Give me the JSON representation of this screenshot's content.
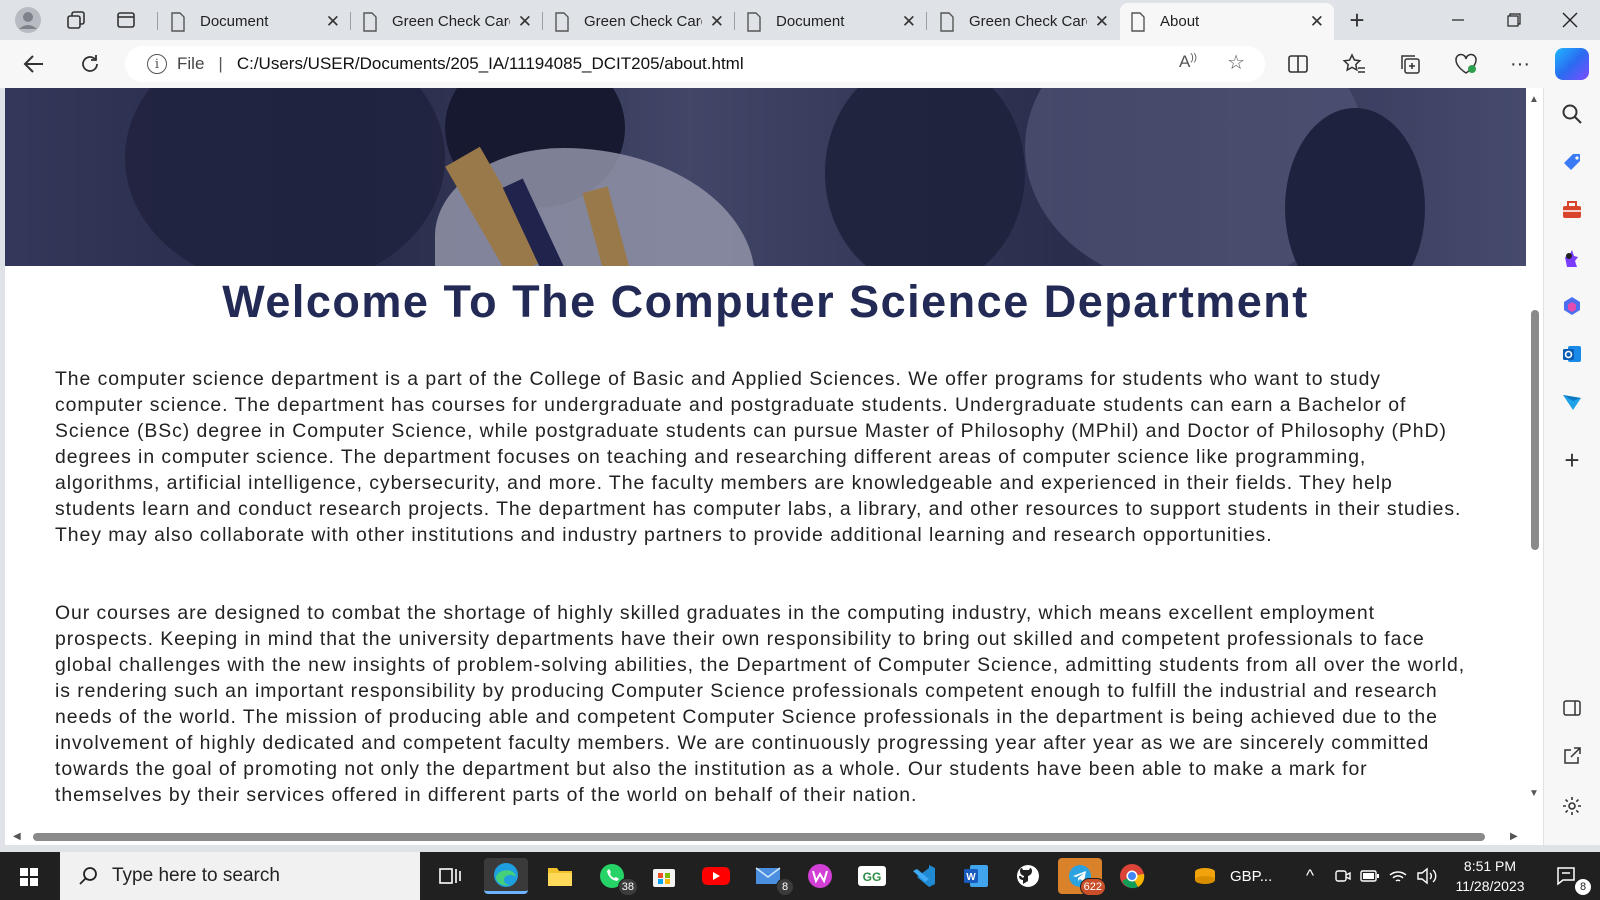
{
  "browser": {
    "tabs": [
      {
        "label": "Document",
        "active": false
      },
      {
        "label": "Green Check Card",
        "active": false
      },
      {
        "label": "Green Check Card",
        "active": false
      },
      {
        "label": "Document",
        "active": false
      },
      {
        "label": "Green Check Card",
        "active": false
      },
      {
        "label": "About",
        "active": true
      }
    ],
    "address": {
      "scheme_label": "File",
      "url": "C:/Users/USER/Documents/205_IA/11194085_DCIT205/about.html"
    }
  },
  "page": {
    "title": "Welcome To The Computer Science Department",
    "paragraphs": [
      "The computer science department is a part of the College of Basic and Applied Sciences. We offer programs for students who want to study computer science. The department has courses for undergraduate and postgraduate students. Undergraduate students can earn a Bachelor of Science (BSc) degree in Computer Science, while postgraduate students can pursue Master of Philosophy (MPhil) and Doctor of Philosophy (PhD) degrees in computer science. The department focuses on teaching and researching different areas of computer science like programming, algorithms, artificial intelligence, cybersecurity, and more. The faculty members are knowledgeable and experienced in their fields. They help students learn and conduct research projects. The department has computer labs, a library, and other resources to support students in their studies. They may also collaborate with other institutions and industry partners to provide additional learning and research opportunities.",
      "Our courses are designed to combat the shortage of highly skilled graduates in the computing industry, which means excellent employment prospects. Keeping in mind that the university departments have their own responsibility to bring out skilled and competent professionals to face global challenges with the new insights of problem-solving abilities, the Department of Computer Science, admitting students from all over the world, is rendering such an important responsibility by producing Computer Science professionals competent enough to fulfill the industrial and research needs of the world. The mission of producing able and competent Computer Science professionals in the department is being achieved due to the involvement of highly dedicated and competent faculty members. We are continuously progressing year after year as we are sincerely committed towards the goal of promoting not only the department but also the institution as a whole. Our students have been able to make a mark for themselves by their services offered in different parts of the world on behalf of their nation."
    ]
  },
  "taskbar": {
    "search_placeholder": "Type here to search",
    "whatsapp_badge": "38",
    "mail_badge": "8",
    "telegram_badge": "622",
    "currency_label": "GBP...",
    "time": "8:51 PM",
    "date": "11/28/2023",
    "notification_badge": "8"
  },
  "colors": {
    "title": "#222a55",
    "text": "#222222",
    "taskbar": "#202020"
  }
}
